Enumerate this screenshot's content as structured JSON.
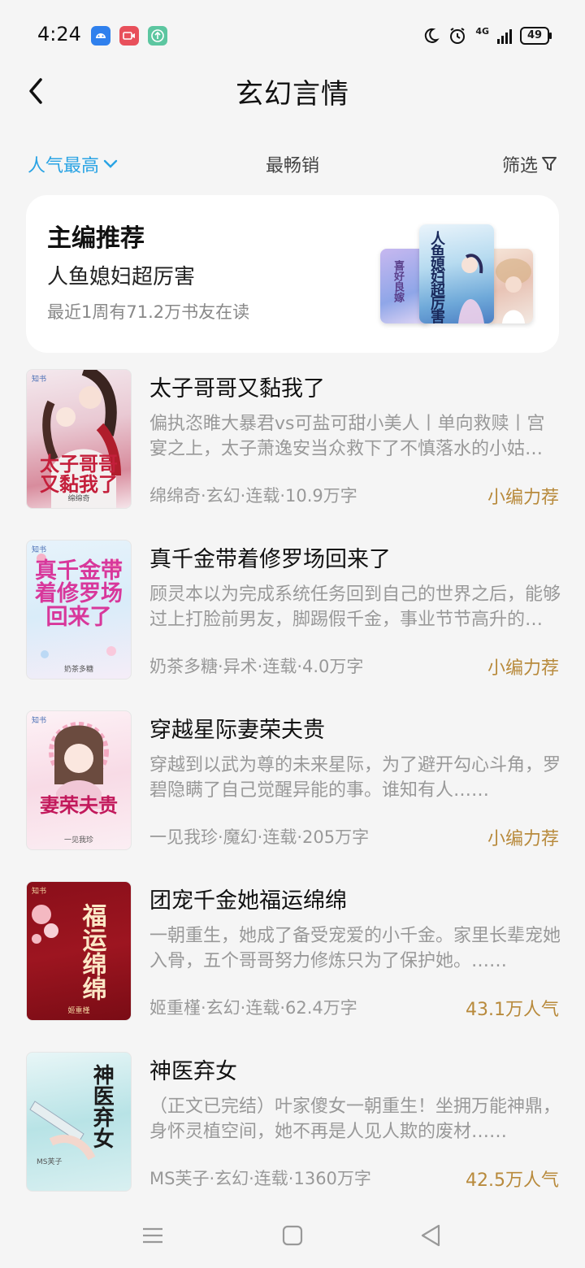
{
  "status_bar": {
    "time": "4:24",
    "network": "4G",
    "battery": "49"
  },
  "header": {
    "title": "玄幻言情",
    "back_icon": "chevron-left-icon"
  },
  "sort_bar": {
    "popular": "人气最高",
    "bestseller": "最畅销",
    "filter": "筛选",
    "active_color": "#29a3e4"
  },
  "featured": {
    "heading": "主编推荐",
    "book": "人鱼媳妇超厉害",
    "readers": "最近1周有71.2万书友在读",
    "covers": {
      "left": "喜好良嫁",
      "center": "人鱼媳妇超厉害",
      "right": ""
    }
  },
  "books": [
    {
      "title": "太子哥哥又黏我了",
      "desc": "偏执恣睢大暴君vs可盐可甜小美人丨单向救赎丨宫宴之上，太子萧逸安当众救下了不慎落水的小姑娘……",
      "meta": "绵绵奇·玄幻·连载·10.9万字",
      "badge": "小编力荐",
      "cover_title": "太子哥哥又黏我了",
      "cover_author": "绵绵奇"
    },
    {
      "title": "真千金带着修罗场回来了",
      "desc": "顾灵本以为完成系统任务回到自己的世界之后，能够过上打脸前男友，脚踢假千金，事业节节高升的生活……",
      "meta": "奶茶多糖·异术·连载·4.0万字",
      "badge": "小编力荐",
      "cover_title": "真千金带着修罗场回来了",
      "cover_author": "奶茶多糖"
    },
    {
      "title": "穿越星际妻荣夫贵",
      "desc": "穿越到以武为尊的未来星际，为了避开勾心斗角，罗碧隐瞒了自己觉醒异能的事。谁知有人……",
      "meta": "一见我珍·魔幻·连载·205万字",
      "badge": "小编力荐",
      "cover_title": "妻荣夫贵",
      "cover_author": "一见我珍"
    },
    {
      "title": "团宠千金她福运绵绵",
      "desc": "一朝重生，她成了备受宠爱的小千金。家里长辈宠她入骨，五个哥哥努力修炼只为了保护她。……",
      "meta": "姬重槿·玄幻·连载·62.4万字",
      "badge": "43.1万人气",
      "cover_title": "福运绵绵",
      "cover_author": "姬重槿"
    },
    {
      "title": "神医弃女",
      "desc": "（正文已完结）叶家傻女一朝重生！坐拥万能神鼎，身怀灵植空间，她不再是人见人欺的废材……",
      "meta": "MS芙子·玄幻·连载·1360万字",
      "badge": "42.5万人气",
      "cover_title": "神医弃女",
      "cover_author": "MS芙子"
    }
  ],
  "nav_bar": {
    "menu_icon": "menu-icon",
    "home_icon": "home-square-icon",
    "back_icon": "triangle-back-icon"
  }
}
